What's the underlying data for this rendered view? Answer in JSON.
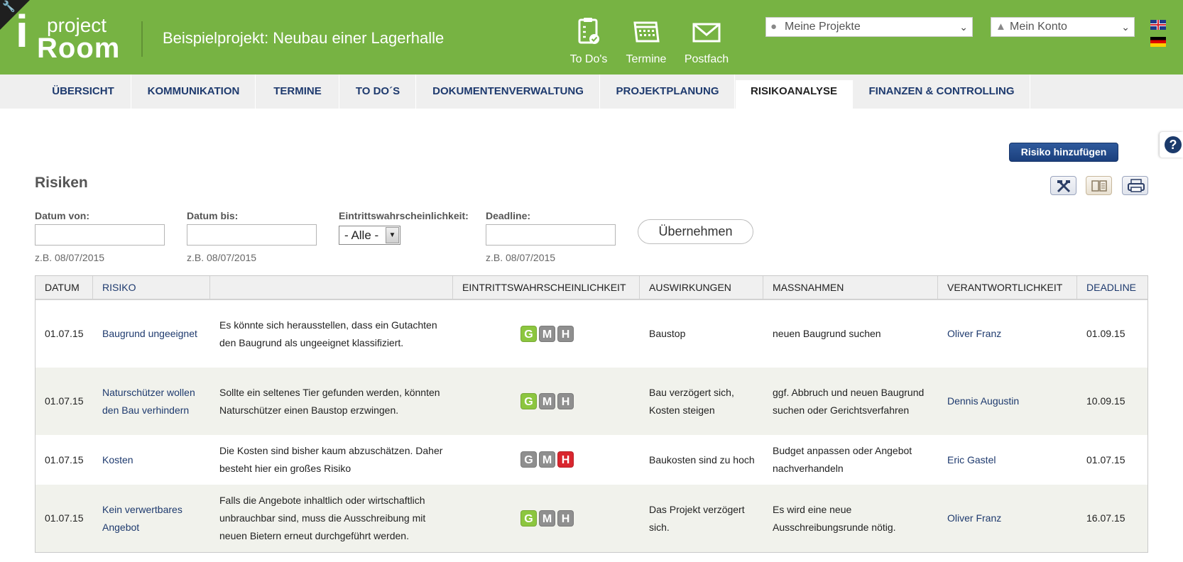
{
  "header": {
    "logo": {
      "letter": "i",
      "top": "project",
      "bottom": "Room"
    },
    "project_title": "Beispielprojekt: Neubau einer Lagerhalle",
    "quick_links": [
      {
        "label": "To Do's",
        "icon": "clipboard-check-icon"
      },
      {
        "label": "Termine",
        "icon": "calendar-icon"
      },
      {
        "label": "Postfach",
        "icon": "envelope-icon"
      }
    ],
    "project_select": {
      "value": "Meine Projekte",
      "icon": "globe-icon"
    },
    "account_select": {
      "value": "Mein Konto",
      "icon": "user-icon"
    },
    "languages": [
      "english-flag-icon",
      "german-flag-icon"
    ],
    "colors": {
      "brand_green": "#77b343",
      "nav_blue": "#1e3a6e"
    }
  },
  "nav": {
    "tabs": [
      {
        "label": "ÜBERSICHT"
      },
      {
        "label": "KOMMUNIKATION"
      },
      {
        "label": "TERMINE"
      },
      {
        "label": "TO DO´S"
      },
      {
        "label": "DOKUMENTENVERWALTUNG"
      },
      {
        "label": "PROJEKTPLANUNG"
      },
      {
        "label": "RISIKOANALYSE",
        "active": true
      },
      {
        "label": "FINANZEN & CONTROLLING"
      }
    ]
  },
  "content": {
    "help_label": "?",
    "add_button": "Risiko hinzufügen",
    "title": "Risiken",
    "tools": [
      "tools-icon",
      "book-icon",
      "print-icon"
    ],
    "filters": {
      "date_from": {
        "label": "Datum von:",
        "value": "",
        "hint": "z.B. 08/07/2015"
      },
      "date_to": {
        "label": "Datum bis:",
        "value": "",
        "hint": "z.B. 08/07/2015"
      },
      "probability": {
        "label": "Eintrittswahrscheinlichkeit:",
        "value": "- Alle -"
      },
      "deadline": {
        "label": "Deadline:",
        "value": "",
        "hint": "z.B. 08/07/2015"
      },
      "apply_button": "Übernehmen"
    },
    "table": {
      "columns": [
        "DATUM",
        "RISIKO",
        "",
        "EINTRITTSWAHRSCHEINLICHKEIT",
        "AUSWIRKUNGEN",
        "MASSNAHMEN",
        "VERANTWORTLICHKEIT",
        "DEADLINE"
      ],
      "rows": [
        {
          "date": "01.07.15",
          "risk": "Baugrund ungeeignet",
          "description": "Es könnte sich herausstellen, dass ein Gutachten den Baugrund als ungeeignet klassifiziert.",
          "probability": "G",
          "impact": "Baustop",
          "measures": "neuen Baugrund suchen",
          "responsible": "Oliver Franz",
          "deadline": "01.09.15"
        },
        {
          "date": "01.07.15",
          "risk": "Naturschützer wollen den Bau verhindern",
          "description": "Sollte ein seltenes Tier gefunden werden, könnten Naturschützer einen Baustop erzwingen.",
          "probability": "G",
          "impact": "Bau verzögert sich, Kosten steigen",
          "measures": "ggf. Abbruch und neuen Baugrund suchen oder Gerichtsverfahren",
          "responsible": "Dennis Augustin",
          "deadline": "10.09.15"
        },
        {
          "date": "01.07.15",
          "risk": "Kosten",
          "description": "Die Kosten sind bisher kaum abzuschätzen. Daher besteht hier ein großes Risiko",
          "probability": "H",
          "impact": "Baukosten sind zu hoch",
          "measures": "Budget anpassen oder Angebot nachverhandeln",
          "responsible": "Eric Gastel",
          "deadline": "01.07.15"
        },
        {
          "date": "01.07.15",
          "risk": "Kein verwertbares Angebot",
          "description": "Falls die Angebote inhaltlich oder wirtschaftlich unbrauchbar sind, muss die Ausschreibung mit neuen Bietern erneut durchgeführt werden.",
          "probability": "G",
          "impact": "Das Projekt verzögert sich.",
          "measures": "Es wird eine neue Ausschreibungsrunde nötig.",
          "responsible": "Oliver Franz",
          "deadline": "16.07.15"
        }
      ],
      "badge_letters": [
        "G",
        "M",
        "H"
      ],
      "badge_colors": {
        "G": "#8cc63f",
        "M": "#8f8f8f",
        "H": "#d9262e",
        "inactive": "#8f8f8f"
      }
    }
  }
}
